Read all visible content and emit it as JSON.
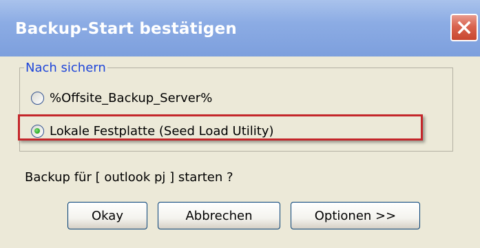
{
  "dialog": {
    "title": "Backup-Start bestätigen",
    "close_icon": "close-icon"
  },
  "group": {
    "legend": "Nach sichern",
    "options": [
      {
        "label": "%Offsite_Backup_Server%",
        "selected": false
      },
      {
        "label": "Lokale Festplatte (Seed Load Utility)",
        "selected": true
      }
    ]
  },
  "prompt": "Backup für [ outlook pj ] starten ?",
  "buttons": {
    "ok": "Okay",
    "cancel": "Abbrechen",
    "options": "Optionen >>"
  },
  "colors": {
    "titlebar": "#8cace4",
    "legend_text": "#1f46d9",
    "highlight_border": "#c4262a"
  }
}
